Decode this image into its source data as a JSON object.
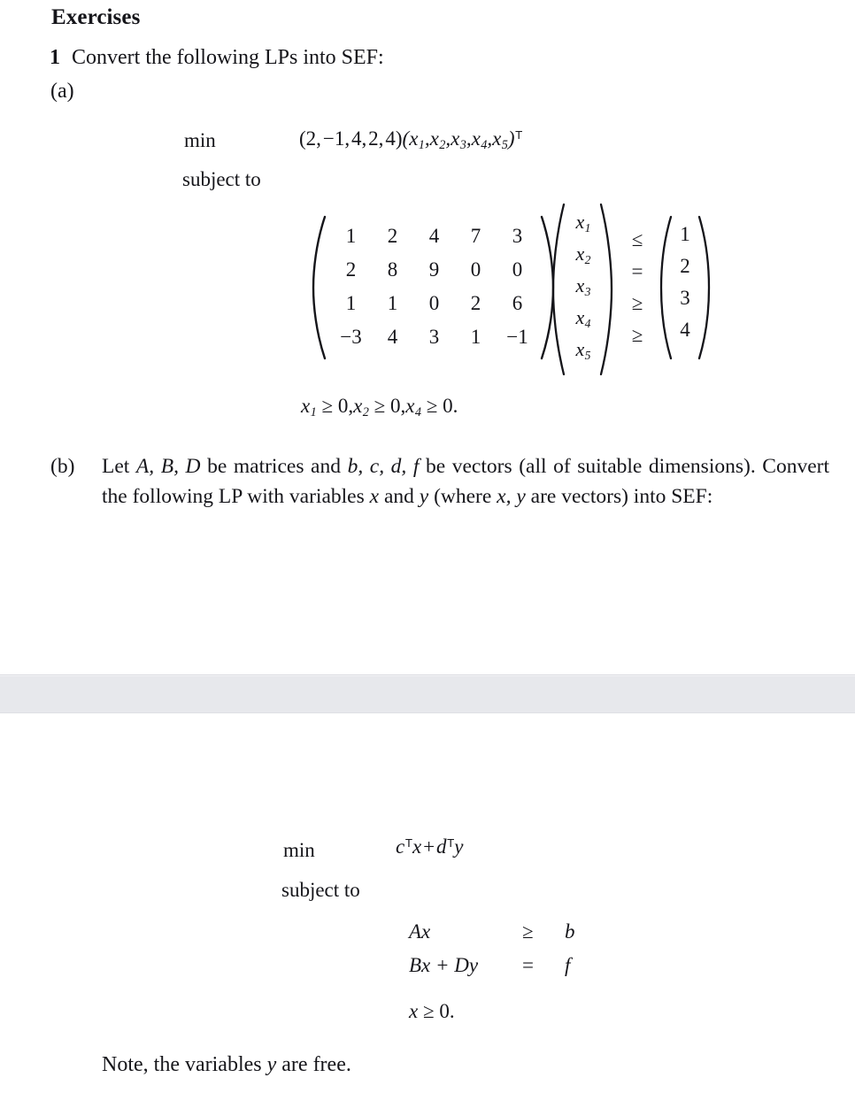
{
  "document": {
    "section_heading": "Exercises",
    "question_number": "1",
    "question_text": "Convert the following LPs into SEF:",
    "part_a_label": "(a)",
    "part_b_label": "(b)",
    "note": {
      "prefix": "Note, the variables ",
      "variable": "y",
      "suffix": " are free."
    },
    "page_gap_color": "#e7e8ec",
    "page_color": "#ffffff",
    "text_color": "#15151a"
  },
  "lp1": {
    "objective_keyword": "min",
    "subject_to_keyword": "subject to",
    "objective": {
      "cost_vector": [
        "2",
        "−1",
        "4",
        "2",
        "4"
      ],
      "variable_vector": [
        "x1",
        "x2",
        "x3",
        "x4",
        "x5"
      ],
      "transpose_marker": "T",
      "rendered": "(2, −1, 4, 2, 4)(x1, x2, x3, x4, x5)ᵀ"
    },
    "matrix": {
      "rows": [
        [
          "1",
          "2",
          "4",
          "7",
          "3"
        ],
        [
          "2",
          "8",
          "9",
          "0",
          "0"
        ],
        [
          "1",
          "1",
          "0",
          "2",
          "6"
        ],
        [
          "−3",
          "4",
          "3",
          "1",
          "−1"
        ]
      ]
    },
    "variables": [
      "x1",
      "x2",
      "x3",
      "x4",
      "x5"
    ],
    "variable_subscripts": [
      "1",
      "2",
      "3",
      "4",
      "5"
    ],
    "relations": [
      "≤",
      "=",
      "≥",
      "≥"
    ],
    "rhs": [
      "1",
      "2",
      "3",
      "4"
    ],
    "nonnegativity": {
      "rendered": "x1 ≥ 0, x2 ≥ 0, x4 ≥ 0.",
      "terms": [
        "x1 ≥ 0",
        "x2 ≥ 0",
        "x4 ≥ 0"
      ],
      "subscripts": [
        "1",
        "2",
        "4"
      ],
      "bound": "0"
    }
  },
  "part_b": {
    "text_segments": {
      "s1": "Let ",
      "m1": "A, B, D",
      "s2": " be matrices and ",
      "m2": "b, c, d, f",
      "s3": " be vectors (all of suitable dimensions). Convert the following LP with variables ",
      "m3": "x",
      "s4": " and ",
      "m4": "y",
      "s5": " (where ",
      "m5": "x, y",
      "s6": " are vectors) into SEF:"
    },
    "full_text": "Let A, B, D be matrices and b, c, d, f be vectors (all of suitable dimensions). Convert the following LP with variables x and y (where x, y are vectors) into SEF:"
  },
  "lp2": {
    "objective_keyword": "min",
    "subject_to_keyword": "subject to",
    "objective": {
      "term1_var": "c",
      "term1_transpose": "T",
      "term1_mult": "x",
      "operator": "+",
      "term2_var": "d",
      "term2_transpose": "T",
      "term2_mult": "y",
      "rendered": "cᵀx + dᵀy"
    },
    "constraints": [
      {
        "lhs_parts": [
          "Ax"
        ],
        "lhs": "Ax",
        "relation": "≥",
        "rhs": "b"
      },
      {
        "lhs_parts": [
          "Bx",
          "+",
          "Dy"
        ],
        "lhs": "Bx + Dy",
        "relation": "=",
        "rhs": "f"
      }
    ],
    "nonnegativity": {
      "variable": "x",
      "relation": "≥",
      "bound": "0.",
      "rendered": "x ≥ 0."
    }
  }
}
